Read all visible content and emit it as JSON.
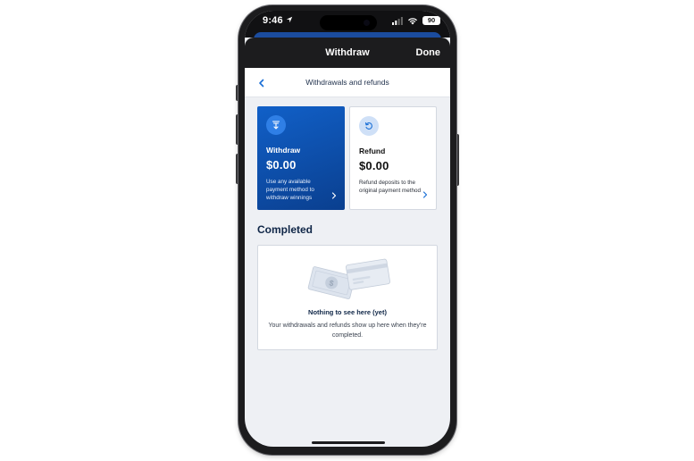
{
  "status_bar": {
    "time": "9:46",
    "battery": "90"
  },
  "header": {
    "title": "Withdraw",
    "done_label": "Done"
  },
  "subheader": {
    "title": "Withdrawals and refunds"
  },
  "cards": {
    "withdraw": {
      "title": "Withdraw",
      "amount": "$0.00",
      "description": "Use any available payment method to withdraw winnings"
    },
    "refund": {
      "title": "Refund",
      "amount": "$0.00",
      "description": "Refund deposits to the original payment method"
    }
  },
  "completed": {
    "title": "Completed",
    "empty_title": "Nothing to see here (yet)",
    "empty_text": "Your withdrawals and refunds show up here when they're completed."
  },
  "icons": {
    "back": "chevron-left-icon",
    "withdraw": "withdraw-arrow-icon",
    "refund": "refund-arrow-icon",
    "chevron": "chevron-right-icon"
  },
  "colors": {
    "brand_blue": "#1160c8",
    "brand_blue_dark": "#0a3f8f",
    "navy_text": "#0f2647",
    "header_bg": "#1c1c1e",
    "screen_bg": "#eef0f4"
  }
}
